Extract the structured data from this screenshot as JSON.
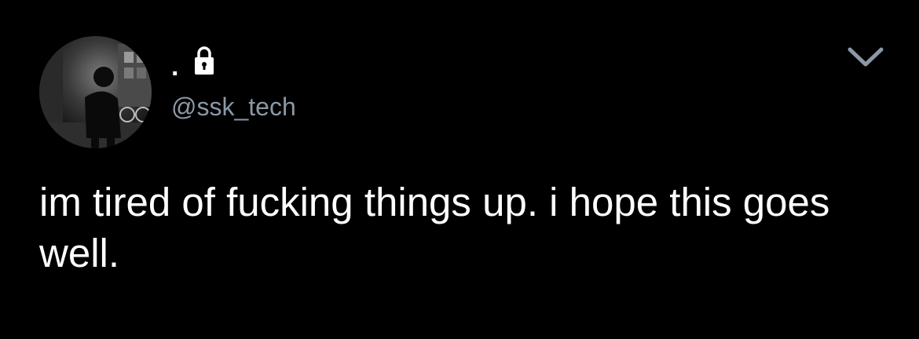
{
  "tweet": {
    "author": {
      "display_name": ".",
      "handle": "@ssk_tech",
      "protected_icon": "lock-icon",
      "avatar": "profile-photo"
    },
    "text": "im tired of fucking things up. i hope this goes well.",
    "menu_icon": "chevron-down-icon"
  },
  "colors": {
    "background": "#000000",
    "text": "#ffffff",
    "secondary_text": "#8b98a5"
  }
}
